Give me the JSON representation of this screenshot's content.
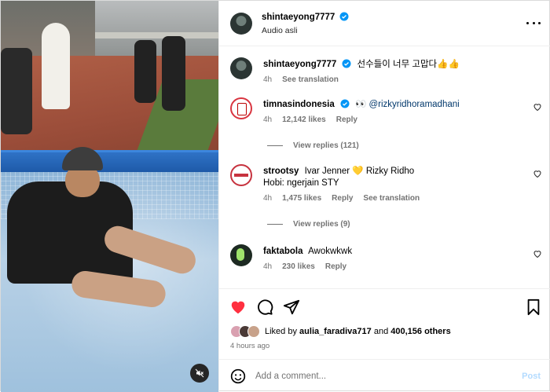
{
  "post": {
    "author": "shintaeyong7777",
    "audio": "Audio asli",
    "more_icon": "more-horizontal-icon",
    "mute_icon": "speaker-muted-icon"
  },
  "caption": {
    "username": "shintaeyong7777",
    "text": "선수들이 너무 고맙다👍👍",
    "time": "4h",
    "translate": "See translation"
  },
  "comments": [
    {
      "username": "timnasindonesia",
      "verified": true,
      "text": "👀 @rizkyridhoramadhani",
      "time": "4h",
      "likes": "12,142 likes",
      "reply": "Reply",
      "view_replies": "View replies (121)"
    },
    {
      "username": "strootsy",
      "verified": false,
      "text": "Ivar Jenner 💛 Rizky Ridho",
      "text2": "Hobi: ngerjain STY",
      "time": "4h",
      "likes": "1,475 likes",
      "reply": "Reply",
      "translate": "See translation",
      "view_replies": "View replies (9)"
    },
    {
      "username": "faktabola",
      "verified": false,
      "text": "Awokwkwk",
      "time": "4h",
      "likes": "230 likes",
      "reply": "Reply"
    }
  ],
  "actions": {
    "like_icon": "heart-filled-icon",
    "comment_icon": "comment-icon",
    "share_icon": "send-icon",
    "save_icon": "bookmark-icon",
    "like_color": "#ff3040"
  },
  "likes": {
    "prefix": "Liked by",
    "user": "aulia_faradiva717",
    "middle": "and",
    "others": "400,156 others"
  },
  "timestamp": "4 hours ago",
  "composer": {
    "placeholder": "Add a comment...",
    "post_label": "Post",
    "emoji_icon": "emoji-icon"
  },
  "colors": {
    "verified": "#0095f6",
    "muted_text": "#737373",
    "post_disabled": "#b3dbff"
  }
}
